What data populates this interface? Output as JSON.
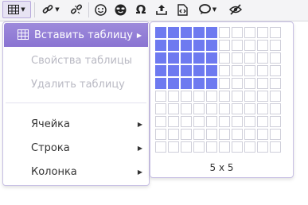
{
  "toolbar": {
    "buttons": [
      {
        "name": "table-button",
        "icon": "table-icon",
        "active": true,
        "dropdown": true
      },
      {
        "name": "link-button",
        "icon": "link-icon",
        "dropdown": true
      },
      {
        "name": "unlink-button",
        "icon": "unlink-icon"
      },
      {
        "name": "emoticon-button",
        "icon": "smiley-icon"
      },
      {
        "name": "cool-emoticon-button",
        "icon": "sunglasses-smiley-icon"
      },
      {
        "name": "special-char-button",
        "icon": "omega-icon"
      },
      {
        "name": "upload-button",
        "icon": "upload-tray-icon"
      },
      {
        "name": "source-code-button",
        "icon": "code-file-icon"
      },
      {
        "name": "spoiler-button",
        "icon": "speech-bubble-icon",
        "dropdown": true
      },
      {
        "name": "hide-button",
        "icon": "eye-slash-icon"
      }
    ]
  },
  "table_menu": {
    "items": [
      {
        "label": "Вставить таблицу",
        "state": "selected",
        "submenu": true
      },
      {
        "label": "Свойства таблицы",
        "state": "disabled"
      },
      {
        "label": "Удалить таблицу",
        "state": "disabled"
      },
      {
        "label": "Ячейка",
        "state": "normal",
        "submenu": true
      },
      {
        "label": "Строка",
        "state": "normal",
        "submenu": true
      },
      {
        "label": "Колонка",
        "state": "normal",
        "submenu": true
      }
    ]
  },
  "table_grid": {
    "columns": 10,
    "rows": 10,
    "selected_columns": 5,
    "selected_rows": 5,
    "size_label": "5 x 5"
  },
  "colors": {
    "menu_selected": "#8f7ad6",
    "grid_selected": "#6e7af0",
    "toolbar_bg": "#f4f4f6"
  }
}
